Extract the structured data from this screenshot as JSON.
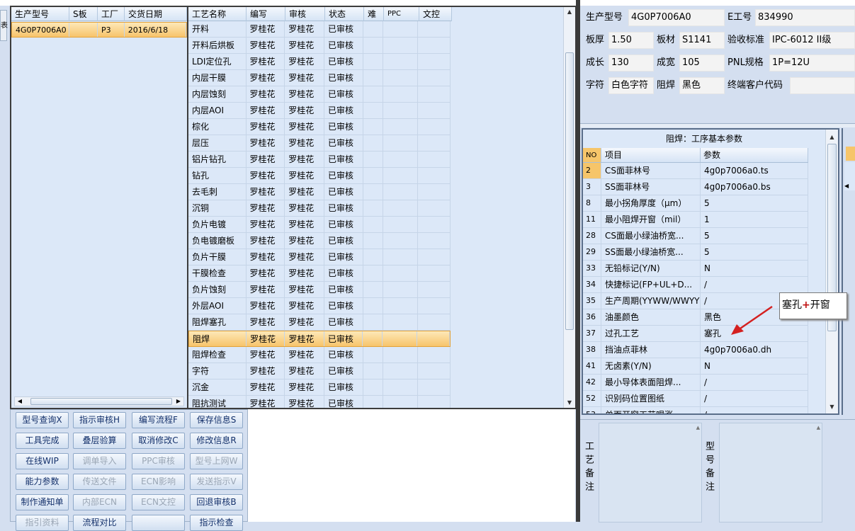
{
  "left_grid": {
    "headers": [
      "生产型号",
      "S板",
      "工厂",
      "交货日期"
    ],
    "rows": [
      [
        "4G0P7006A0",
        "",
        "P3",
        "2016/6/18"
      ]
    ]
  },
  "process_grid": {
    "headers": [
      "工艺名称",
      "编写",
      "审核",
      "状态",
      "难",
      "PPC",
      "文控"
    ],
    "rows": [
      [
        "开料",
        "罗桂花",
        "罗桂花",
        "已审核"
      ],
      [
        "开料后烘板",
        "罗桂花",
        "罗桂花",
        "已审核"
      ],
      [
        "LDI定位孔",
        "罗桂花",
        "罗桂花",
        "已审核"
      ],
      [
        "内层干膜",
        "罗桂花",
        "罗桂花",
        "已审核"
      ],
      [
        "内层蚀刻",
        "罗桂花",
        "罗桂花",
        "已审核"
      ],
      [
        "内层AOI",
        "罗桂花",
        "罗桂花",
        "已审核"
      ],
      [
        "棕化",
        "罗桂花",
        "罗桂花",
        "已审核"
      ],
      [
        "层压",
        "罗桂花",
        "罗桂花",
        "已审核"
      ],
      [
        "铝片钻孔",
        "罗桂花",
        "罗桂花",
        "已审核"
      ],
      [
        "钻孔",
        "罗桂花",
        "罗桂花",
        "已审核"
      ],
      [
        "去毛刺",
        "罗桂花",
        "罗桂花",
        "已审核"
      ],
      [
        "沉铜",
        "罗桂花",
        "罗桂花",
        "已审核"
      ],
      [
        "负片电镀",
        "罗桂花",
        "罗桂花",
        "已审核"
      ],
      [
        "负电镀磨板",
        "罗桂花",
        "罗桂花",
        "已审核"
      ],
      [
        "负片干膜",
        "罗桂花",
        "罗桂花",
        "已审核"
      ],
      [
        "干膜检查",
        "罗桂花",
        "罗桂花",
        "已审核"
      ],
      [
        "负片蚀刻",
        "罗桂花",
        "罗桂花",
        "已审核"
      ],
      [
        "外层AOI",
        "罗桂花",
        "罗桂花",
        "已审核"
      ],
      [
        "阻焊塞孔",
        "罗桂花",
        "罗桂花",
        "已审核"
      ],
      [
        "阻焊",
        "罗桂花",
        "罗桂花",
        "已审核"
      ],
      [
        "阻焊检查",
        "罗桂花",
        "罗桂花",
        "已审核"
      ],
      [
        "字符",
        "罗桂花",
        "罗桂花",
        "已审核"
      ],
      [
        "沉金",
        "罗桂花",
        "罗桂花",
        "已审核"
      ],
      [
        "阻抗测试",
        "罗桂花",
        "罗桂花",
        "已审核"
      ]
    ],
    "selected_index": 19
  },
  "buttons": [
    {
      "label": "型号查询X",
      "enabled": true
    },
    {
      "label": "指示审核H",
      "enabled": true
    },
    {
      "label": "编写流程F",
      "enabled": true
    },
    {
      "label": "保存信息S",
      "enabled": true
    },
    {
      "label": "工具完成",
      "enabled": true
    },
    {
      "label": "叠层验算",
      "enabled": true
    },
    {
      "label": "取消修改C",
      "enabled": true
    },
    {
      "label": "修改信息R",
      "enabled": true
    },
    {
      "label": "在线WIP",
      "enabled": true
    },
    {
      "label": "调单导入",
      "enabled": false
    },
    {
      "label": "PPC审核",
      "enabled": false
    },
    {
      "label": "型号上网W",
      "enabled": false
    },
    {
      "label": "能力参数",
      "enabled": true
    },
    {
      "label": "传送文件",
      "enabled": false
    },
    {
      "label": "ECN影响",
      "enabled": false
    },
    {
      "label": "发送指示V",
      "enabled": false
    },
    {
      "label": "制作通知单",
      "enabled": true
    },
    {
      "label": "内部ECN",
      "enabled": false
    },
    {
      "label": "ECN文控",
      "enabled": false
    },
    {
      "label": "回退审核B",
      "enabled": true
    },
    {
      "label": "指引资料",
      "enabled": false
    },
    {
      "label": "流程对比",
      "enabled": true
    },
    {
      "label": "",
      "enabled": false
    },
    {
      "label": "指示检查",
      "enabled": true
    }
  ],
  "info": {
    "model_label": "生产型号",
    "model_value": "4G0P7006A0",
    "e_label": "E工号",
    "e_value": "834990",
    "thick_label": "板厚",
    "thick_value": "1.50",
    "material_label": "板材",
    "material_value": "S1141",
    "std_label": "验收标准",
    "std_value": "IPC-6012 II级",
    "length_label": "成长",
    "length_value": "130",
    "width_label": "成宽",
    "width_value": "105",
    "pnl_label": "PNL规格",
    "pnl_value": "1P=12U",
    "char_label": "字符",
    "char_value": "白色字符",
    "mask_label": "阻焊",
    "mask_value": "黑色",
    "cust_label": "终端客户代码",
    "cust_value": ""
  },
  "param_panel": {
    "title": "阻焊：工序基本参数",
    "headers": [
      "NO",
      "项目",
      "参数"
    ],
    "rows": [
      [
        "2",
        "CS面菲林号",
        "4g0p7006a0.ts"
      ],
      [
        "3",
        "SS面菲林号",
        "4g0p7006a0.bs"
      ],
      [
        "8",
        "最小拐角厚度（μm）",
        "5"
      ],
      [
        "11",
        "最小阻焊开窗（mil）",
        "1"
      ],
      [
        "28",
        "CS面最小绿油桥宽...",
        "5"
      ],
      [
        "29",
        "SS面最小绿油桥宽...",
        "5"
      ],
      [
        "33",
        "无铅标记(Y/N)",
        "N"
      ],
      [
        "34",
        "快捷标记(FP+UL+D...",
        "/"
      ],
      [
        "35",
        "生产周期(YYWW/WWYY)",
        "/"
      ],
      [
        "36",
        "油墨颜色",
        "黑色"
      ],
      [
        "37",
        "过孔工艺",
        "塞孔"
      ],
      [
        "38",
        "挡油点菲林",
        "4g0p7006a0.dh"
      ],
      [
        "41",
        "无卤素(Y/N)",
        "N"
      ],
      [
        "42",
        "最小导体表面阻焊...",
        "/"
      ],
      [
        "52",
        "识别码位置图纸",
        "/"
      ],
      [
        "53",
        "单面开窗工艺喝涨...",
        "/"
      ]
    ]
  },
  "annotation": {
    "text_a": "塞孔",
    "text_plus": "+",
    "text_b": "开窗",
    "arrow_color": "#d42020"
  },
  "remarks": {
    "process_label": "工艺备注",
    "model_label": "型号备注"
  },
  "left_edge_char": "表"
}
